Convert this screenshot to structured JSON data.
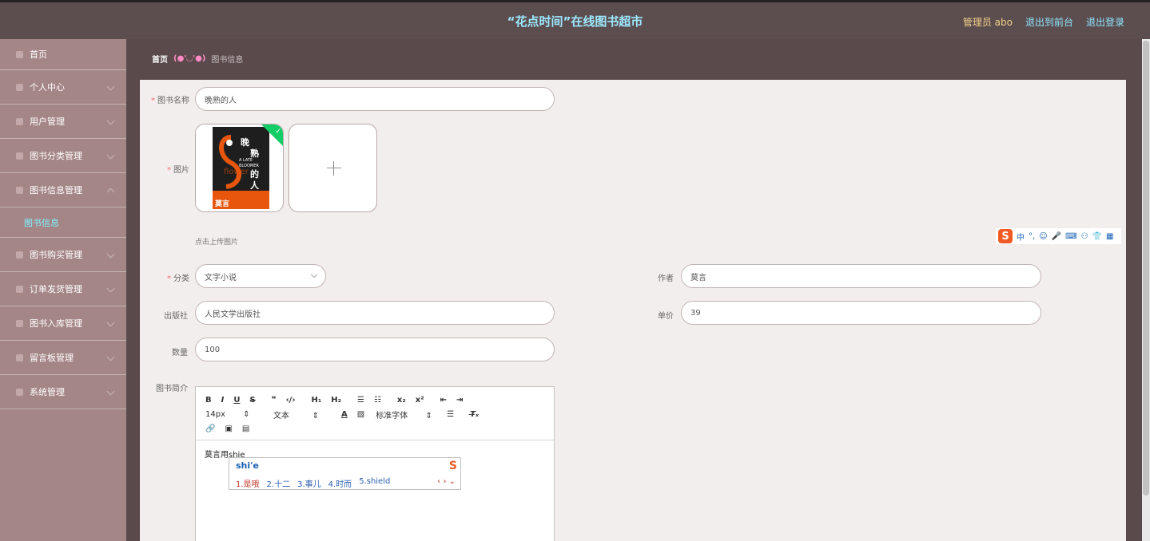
{
  "header": {
    "title": "“花点时间”在线图书超市",
    "admin": "管理员 abo",
    "front_link": "退出到前台",
    "logout_link": "退出登录"
  },
  "sidebar": {
    "items": [
      {
        "label": "首页",
        "icon": "home-icon"
      },
      {
        "label": "个人中心",
        "icon": "user-icon"
      },
      {
        "label": "用户管理",
        "icon": "users-icon"
      },
      {
        "label": "图书分类管理",
        "icon": "category-icon"
      },
      {
        "label": "图书信息管理",
        "icon": "book-icon"
      },
      {
        "label": "图书购买管理",
        "icon": "cart-icon"
      },
      {
        "label": "订单发货管理",
        "icon": "order-icon"
      },
      {
        "label": "图书入库管理",
        "icon": "stock-icon"
      },
      {
        "label": "留言板管理",
        "icon": "message-icon"
      },
      {
        "label": "系统管理",
        "icon": "system-icon"
      }
    ],
    "sub_item": "图书信息"
  },
  "breadcrumb": {
    "home": "首页",
    "separator": "(●'◡'●)",
    "current": "图书信息"
  },
  "form": {
    "name_label": "图书名称",
    "name_value": "晚熟的人",
    "image_label": "图片",
    "upload_hint": "点击上传图片",
    "book_cover_title": "晚熟的人",
    "book_cover_en": "A LATE BLOOMER",
    "book_cover_author": "莫言",
    "category_label": "分类",
    "category_value": "文字小说",
    "author_label": "作者",
    "author_value": "莫言",
    "publisher_label": "出版社",
    "publisher_value": "人民文学出版社",
    "price_label": "单价",
    "price_value": "39",
    "qty_label": "数量",
    "qty_value": "100",
    "intro_label": "图书简介"
  },
  "editor": {
    "row1": [
      "B",
      "I",
      "U",
      "S",
      "❞",
      "‹/›",
      "H₁",
      "H₂",
      "☰",
      "☷",
      "x₂",
      "x²",
      "⇤",
      "⇥"
    ],
    "font_size": "14px",
    "text_type": "文本",
    "font_family": "标准字体",
    "content": "莫言用shie"
  },
  "ime": {
    "toolbar": [
      "中",
      "°,",
      "☺",
      "🎤",
      "⌨",
      "⚇",
      "👕",
      "▦"
    ],
    "pinyin": "shi'e",
    "candidates": [
      "1.是哦",
      "2.十二",
      "3.事儿",
      "4.时而",
      "5.shield"
    ],
    "nav": "‹ › ⌄"
  }
}
